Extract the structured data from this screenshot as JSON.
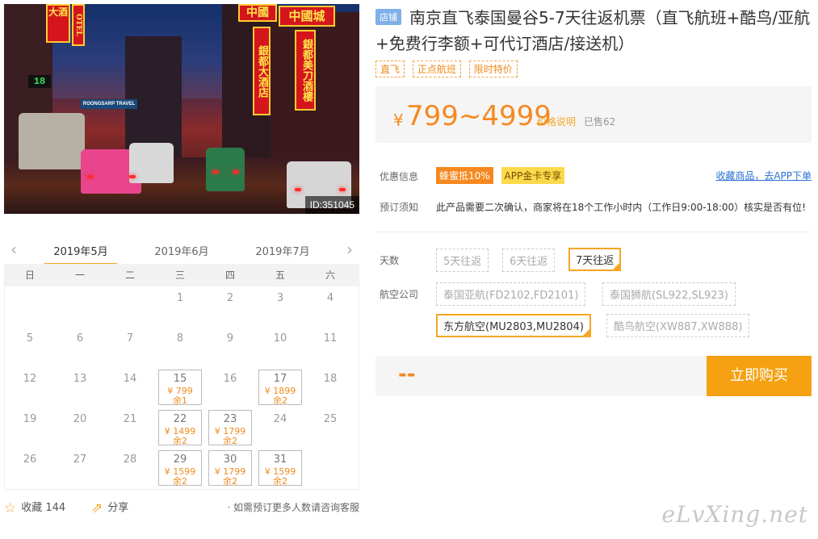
{
  "photo": {
    "image_id": "ID:351045",
    "signs": [
      "中國",
      "中國城",
      "大酒",
      "OTEL",
      "ROONGSARP TRAVEL",
      "銀都大酒店",
      "銀都美刀酒樓",
      "18"
    ]
  },
  "calendar": {
    "months": [
      "2019年5月",
      "2019年6月",
      "2019年7月"
    ],
    "weekdays": [
      "日",
      "一",
      "二",
      "三",
      "四",
      "五",
      "六"
    ],
    "days": [
      {
        "d": ""
      },
      {
        "d": ""
      },
      {
        "d": ""
      },
      {
        "d": "1"
      },
      {
        "d": "2"
      },
      {
        "d": "3"
      },
      {
        "d": "4"
      },
      {
        "d": "5"
      },
      {
        "d": "6"
      },
      {
        "d": "7"
      },
      {
        "d": "8"
      },
      {
        "d": "9"
      },
      {
        "d": "10"
      },
      {
        "d": "11"
      },
      {
        "d": "12"
      },
      {
        "d": "13"
      },
      {
        "d": "14"
      },
      {
        "d": "15",
        "price": "¥ 799",
        "stock": "余1"
      },
      {
        "d": "16"
      },
      {
        "d": "17",
        "price": "¥ 1899",
        "stock": "余2"
      },
      {
        "d": "18"
      },
      {
        "d": "19"
      },
      {
        "d": "20"
      },
      {
        "d": "21"
      },
      {
        "d": "22",
        "price": "¥ 1499",
        "stock": "余2"
      },
      {
        "d": "23",
        "price": "¥ 1799",
        "stock": "余2"
      },
      {
        "d": "24"
      },
      {
        "d": "25"
      },
      {
        "d": "26"
      },
      {
        "d": "27"
      },
      {
        "d": "28"
      },
      {
        "d": "29",
        "price": "¥ 1599",
        "stock": "余2"
      },
      {
        "d": "30",
        "price": "¥ 1799",
        "stock": "余2"
      },
      {
        "d": "31",
        "price": "¥ 1599",
        "stock": "余2"
      },
      {
        "d": ""
      }
    ]
  },
  "footer": {
    "fav_label": "收藏 144",
    "share_label": "分享",
    "note": "· 如需预订更多人数请咨询客服"
  },
  "product": {
    "store_tag": "店铺",
    "title": "南京直飞泰国曼谷5-7天往返机票（直飞航班+酷鸟/亚航+免费行李额+可代订酒店/接送机）",
    "tags": [
      "直飞",
      "正点航班",
      "限时特价"
    ],
    "currency": "¥",
    "price_range": "799~4999",
    "price_note": "价格说明",
    "sold": "已售62"
  },
  "promo": {
    "label": "优惠信息",
    "badges": [
      "蜂蜜抵10%",
      "APP金卡专享"
    ],
    "fav_link": "收藏商品，去APP下单"
  },
  "notice": {
    "label": "预订须知",
    "text": "此产品需要二次确认，商家将在18个工作小时内（工作日9:00-18:00）核实是否有位!"
  },
  "days_option": {
    "label": "天数",
    "options": [
      "5天往返",
      "6天往返",
      "7天往返"
    ],
    "selected": "7天往返"
  },
  "airline_option": {
    "label": "航空公司",
    "options": [
      "泰国亚航(FD2102,FD2101)",
      "泰国狮航(SL922,SL923)",
      "东方航空(MU2803,MU2804)",
      "酷鸟航空(XW887,XW888)"
    ],
    "selected": "东方航空(MU2803,MU2804)"
  },
  "purchase": {
    "qty_placeholder": "--",
    "buy_label": "立即购买"
  },
  "watermark": "eLvXing.net",
  "colors": {
    "accent": "#f5a623",
    "price": "#f5891f",
    "link": "#2a6fd6"
  }
}
